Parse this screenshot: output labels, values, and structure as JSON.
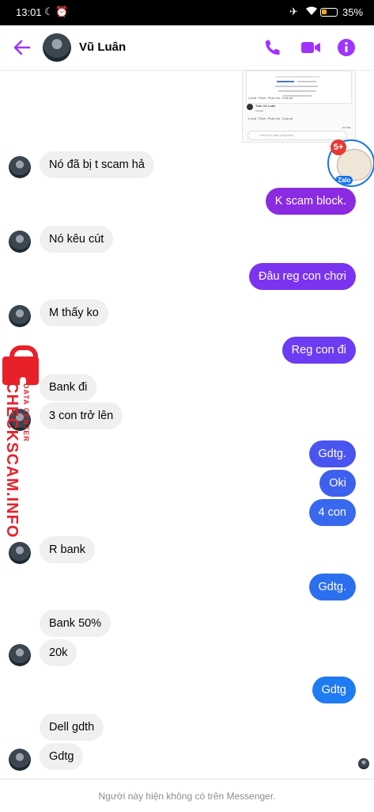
{
  "status_bar": {
    "time": "13:01",
    "battery": "35%",
    "battery_level": 0.35
  },
  "header": {
    "contact_name": "Vũ Luân",
    "accent_color": "#a033ff"
  },
  "thumbnail": {
    "sender_name": "Trần Vũ Luân",
    "reply_placeholder": "Viết bình luận công khai...",
    "actions": [
      "1 phút",
      "Thích",
      "Phản hồi",
      "Chia sẻ"
    ],
    "tag": "Gửi đến"
  },
  "sticker": {
    "badge": "5+",
    "label": "Zalo"
  },
  "watermark": {
    "text": "CHECKSCAM.INFO",
    "sub": "DATA CENTER"
  },
  "messages": [
    {
      "side": "in",
      "text": "Nó đã bị t scam hả"
    },
    {
      "side": "out",
      "text": "K scam block.",
      "color": "#8a2be2"
    },
    {
      "side": "in",
      "text": "Nó kêu cút"
    },
    {
      "side": "out",
      "text": "Đâu reg con chơi",
      "color": "#7b33f0"
    },
    {
      "side": "in",
      "text": "M thấy ko"
    },
    {
      "side": "out",
      "text": "Reg con đi",
      "color": "#6b3cf2"
    },
    {
      "side": "in",
      "text": "Bank đi"
    },
    {
      "side": "in",
      "text": "3 con trở lên"
    },
    {
      "side": "out",
      "text": "Gdtg.",
      "color": "#4a55f0"
    },
    {
      "side": "out",
      "text": "Oki",
      "color": "#3e60ee"
    },
    {
      "side": "out",
      "text": "4 con",
      "color": "#3868ee"
    },
    {
      "side": "in",
      "text": "R bank"
    },
    {
      "side": "out",
      "text": "Gdtg.",
      "color": "#2c6fee"
    },
    {
      "side": "in",
      "text": "Bank 50%"
    },
    {
      "side": "in",
      "text": "20k"
    },
    {
      "side": "out",
      "text": "Gdtg",
      "color": "#1f7bf2"
    },
    {
      "side": "in",
      "text": "Dell gdth"
    },
    {
      "side": "in",
      "text": "Gdtg"
    }
  ],
  "footer": {
    "notice": "Người này hiện không có trên Messenger."
  }
}
